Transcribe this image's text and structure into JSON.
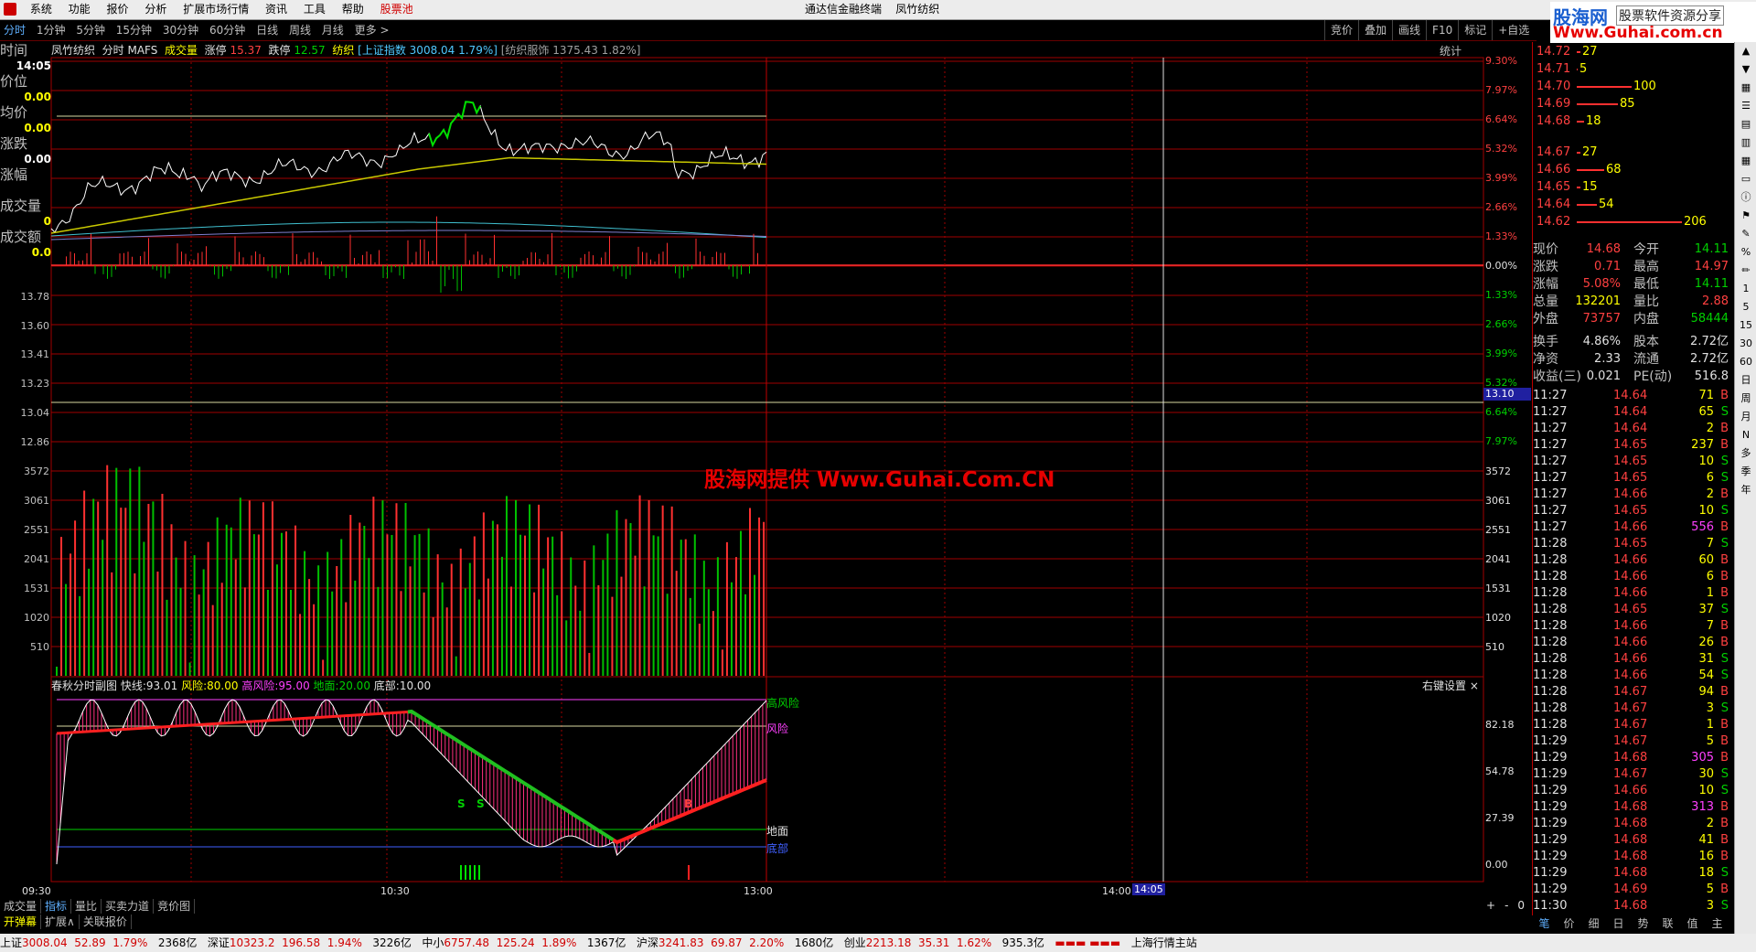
{
  "menu": {
    "items": [
      "系统",
      "功能",
      "报价",
      "分析",
      "扩展市场行情",
      "资讯",
      "工具",
      "帮助"
    ],
    "highlight": "股票池",
    "title_left": "通达信金融终端",
    "title_right": "凤竹纺织"
  },
  "logo": {
    "cn": "股海网",
    "tag": "股票软件资源分享",
    "url": "Www.Guhai.com.cn"
  },
  "periods": [
    "分时",
    "1分钟",
    "5分钟",
    "15分钟",
    "30分钟",
    "60分钟",
    "日线",
    "周线",
    "月线",
    "更多 >"
  ],
  "right_buttons": [
    "竞价",
    "叠加",
    "画线",
    "F10",
    "标记",
    "+自选"
  ],
  "info_row": {
    "name": "凤竹纺织",
    "mode": "分时 MAFS",
    "vol_label": "成交量",
    "limit_up_label": "涨停",
    "limit_up": "15.37",
    "limit_down_label": "跌停",
    "limit_down": "12.57",
    "sector": "纺织",
    "index": "[上证指数 3008.04 1.79%]",
    "industry": "[纺织服饰 1375.43 1.82%]",
    "stats": "统计"
  },
  "left_panel": {
    "title": "时间",
    "time": "14:05",
    "price_label": "价位",
    "price": "0.00",
    "avg_label": "均价",
    "avg": "0.00",
    "chg_label": "涨跌",
    "chg": "0.00",
    "pct_label": "涨幅",
    "vol_label": "成交量",
    "vol": "0",
    "amt_label": "成交额",
    "amt": "0.0"
  },
  "price_axis_left": [
    "13.78",
    "13.60",
    "13.41",
    "13.23",
    "13.04",
    "12.86"
  ],
  "price_axis_right": [
    "9.30%",
    "7.97%",
    "6.64%",
    "5.32%",
    "3.99%",
    "2.66%",
    "1.33%",
    "0.00%",
    "1.33%",
    "2.66%",
    "3.99%",
    "5.32%",
    "6.64%",
    "7.97%"
  ],
  "price_cursor": "13.10",
  "vol_axis": [
    "3572",
    "3061",
    "2551",
    "2041",
    "1531",
    "1020",
    "510"
  ],
  "indicator": {
    "header": "春秋分时副图",
    "fast_label": "快线:",
    "fast": "93.01",
    "risk_label": "风险:",
    "risk": "80.00",
    "hi_risk_label": "高风险:",
    "hi_risk": "95.00",
    "ground_label": "地面:",
    "ground": "20.00",
    "bottom_label": "底部:",
    "bottom": "10.00",
    "settings": "右键设置",
    "close": "×",
    "axis": [
      "82.18",
      "54.78",
      "27.39",
      "0.00"
    ],
    "tag_hi": "高风险",
    "tag_risk": "风险",
    "tag_ground": "地面",
    "tag_bottom": "底部",
    "signal_s1": "S",
    "signal_s2": "S",
    "signal_b": "B"
  },
  "time_axis": [
    "09:30",
    "10:30",
    "13:00",
    "14:00",
    "14:05"
  ],
  "order_book": {
    "asks": [
      {
        "price": "14.72",
        "vol": "27",
        "w": 4
      },
      {
        "price": "14.71",
        "vol": "5",
        "w": 1
      },
      {
        "price": "14.70",
        "vol": "100",
        "w": 60
      },
      {
        "price": "14.69",
        "vol": "85",
        "w": 45
      },
      {
        "price": "14.68",
        "vol": "18",
        "w": 8
      }
    ],
    "bids": [
      {
        "price": "14.67",
        "vol": "27",
        "w": 4
      },
      {
        "price": "14.66",
        "vol": "68",
        "w": 30
      },
      {
        "price": "14.65",
        "vol": "15",
        "w": 4
      },
      {
        "price": "14.64",
        "vol": "54",
        "w": 22
      },
      {
        "price": "14.62",
        "vol": "206",
        "w": 115
      }
    ]
  },
  "quote": [
    {
      "l1": "现价",
      "v1": "14.68",
      "c1": "red",
      "l2": "今开",
      "v2": "14.11",
      "c2": "grn"
    },
    {
      "l1": "涨跌",
      "v1": "0.71",
      "c1": "red",
      "l2": "最高",
      "v2": "14.97",
      "c2": "red"
    },
    {
      "l1": "涨幅",
      "v1": "5.08%",
      "c1": "red",
      "l2": "最低",
      "v2": "14.11",
      "c2": "grn"
    },
    {
      "l1": "总量",
      "v1": "132201",
      "c1": "yel",
      "l2": "量比",
      "v2": "2.88",
      "c2": "red"
    },
    {
      "l1": "外盘",
      "v1": "73757",
      "c1": "red",
      "l2": "内盘",
      "v2": "58444",
      "c2": "grn"
    },
    {
      "l1": "换手",
      "v1": "4.86%",
      "c1": "wht",
      "l2": "股本",
      "v2": "2.72亿",
      "c2": "wht"
    },
    {
      "l1": "净资",
      "v1": "2.33",
      "c1": "wht",
      "l2": "流通",
      "v2": "2.72亿",
      "c2": "wht"
    },
    {
      "l1": "收益(三)",
      "v1": "0.021",
      "c1": "wht",
      "l2": "PE(动)",
      "v2": "516.8",
      "c2": "wht"
    }
  ],
  "ticks": [
    [
      "11:27",
      "14.64",
      "71",
      "B"
    ],
    [
      "11:27",
      "14.64",
      "65",
      "S"
    ],
    [
      "11:27",
      "14.64",
      "2",
      "B"
    ],
    [
      "11:27",
      "14.65",
      "237",
      "B"
    ],
    [
      "11:27",
      "14.65",
      "10",
      "S"
    ],
    [
      "11:27",
      "14.65",
      "6",
      "S"
    ],
    [
      "11:27",
      "14.66",
      "2",
      "B"
    ],
    [
      "11:27",
      "14.65",
      "10",
      "S"
    ],
    [
      "11:27",
      "14.66",
      "556",
      "B"
    ],
    [
      "11:28",
      "14.65",
      "7",
      "S"
    ],
    [
      "11:28",
      "14.66",
      "60",
      "B"
    ],
    [
      "11:28",
      "14.66",
      "6",
      "B"
    ],
    [
      "11:28",
      "14.66",
      "1",
      "B"
    ],
    [
      "11:28",
      "14.65",
      "37",
      "S"
    ],
    [
      "11:28",
      "14.66",
      "7",
      "B"
    ],
    [
      "11:28",
      "14.66",
      "26",
      "B"
    ],
    [
      "11:28",
      "14.66",
      "31",
      "S"
    ],
    [
      "11:28",
      "14.66",
      "54",
      "S"
    ],
    [
      "11:28",
      "14.67",
      "94",
      "B"
    ],
    [
      "11:28",
      "14.67",
      "3",
      "S"
    ],
    [
      "11:28",
      "14.67",
      "1",
      "B"
    ],
    [
      "11:29",
      "14.67",
      "5",
      "B"
    ],
    [
      "11:29",
      "14.68",
      "305",
      "B"
    ],
    [
      "11:29",
      "14.67",
      "30",
      "S"
    ],
    [
      "11:29",
      "14.66",
      "10",
      "S"
    ],
    [
      "11:29",
      "14.68",
      "313",
      "B"
    ],
    [
      "11:29",
      "14.68",
      "2",
      "B"
    ],
    [
      "11:29",
      "14.68",
      "41",
      "B"
    ],
    [
      "11:29",
      "14.68",
      "16",
      "B"
    ],
    [
      "11:29",
      "14.68",
      "18",
      "S"
    ],
    [
      "11:29",
      "14.69",
      "5",
      "B"
    ],
    [
      "11:30",
      "14.68",
      "3",
      "S"
    ]
  ],
  "right_tabs": [
    "笔",
    "价",
    "细",
    "日",
    "势",
    "联",
    "值",
    "主"
  ],
  "bottom_tabs1": [
    "成交量",
    "指标",
    "量比",
    "买卖力道",
    "竞价图"
  ],
  "bottom_tabs1_right": [
    "+",
    "-",
    "0"
  ],
  "bottom_tabs2": [
    "开弹幕",
    "扩展∧",
    "关联报价"
  ],
  "sidebar": [
    "1",
    "5",
    "15",
    "30",
    "60",
    "日",
    "周",
    "月",
    "N",
    "多",
    "季",
    "年"
  ],
  "status": {
    "sh_label": "上证",
    "sh": "3008.04",
    "sh_chg": "52.89",
    "sh_pct": "1.79%",
    "sh_amt": "2368亿",
    "sz_label": "深证",
    "sz": "10323.2",
    "sz_chg": "196.58",
    "sz_pct": "1.94%",
    "sz_amt": "3226亿",
    "zx_label": "中小",
    "zx": "6757.48",
    "zx_chg": "125.24",
    "zx_pct": "1.89%",
    "zx_amt": "1367亿",
    "hs_label": "沪深",
    "hs": "3241.83",
    "hs_chg": "69.87",
    "hs_pct": "2.20%",
    "hs_amt": "1680亿",
    "cy_label": "创业",
    "cy": "2213.18",
    "cy_chg": "35.31",
    "cy_pct": "1.62%",
    "cy_amt": "935.3亿",
    "station": "上海行情主站"
  },
  "watermark": "股海网提供 Www.Guhai.Com.CN",
  "colors": {
    "up": "#ff4040",
    "down": "#00d000",
    "grid": "#b00000",
    "price": "#ffffff",
    "avg": "#c8c800"
  }
}
